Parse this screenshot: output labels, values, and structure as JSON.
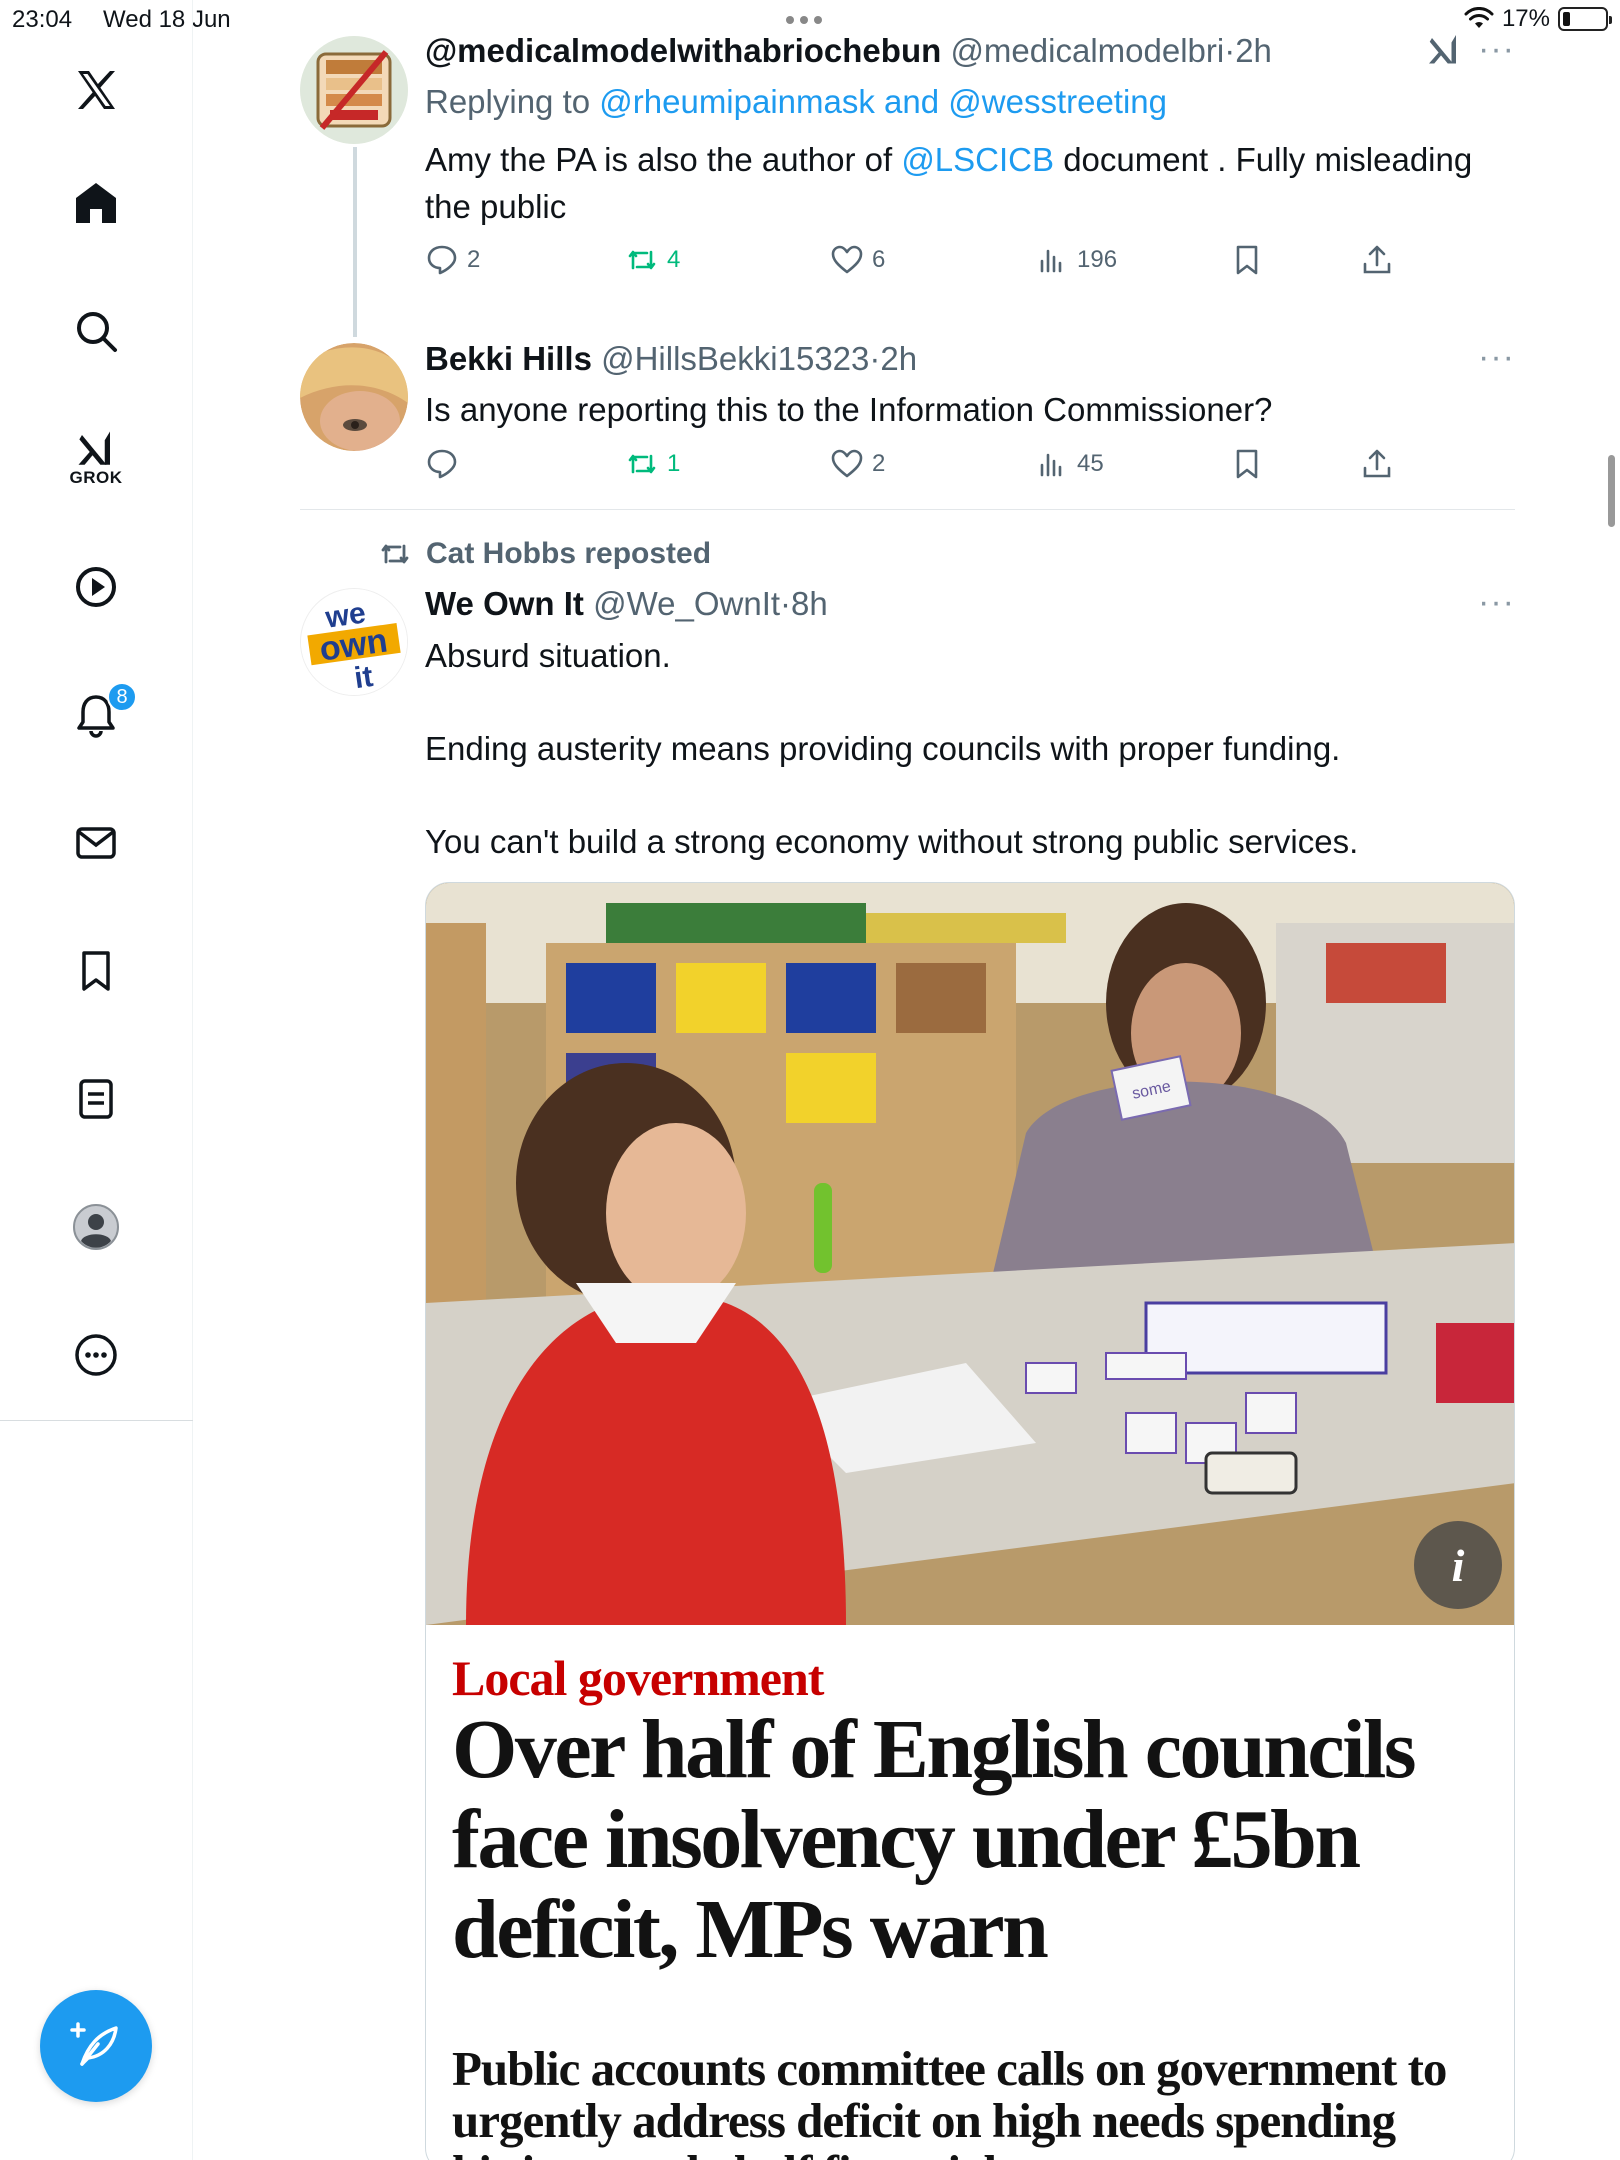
{
  "status_bar": {
    "time": "23:04",
    "date": "Wed 18 Jun",
    "battery_percent_label": "17%",
    "battery_level": 0.17
  },
  "sidebar": {
    "items": [
      {
        "icon": "x-logo-icon"
      },
      {
        "icon": "home-icon"
      },
      {
        "icon": "search-icon"
      },
      {
        "icon": "grok-icon",
        "label": "GROK"
      },
      {
        "icon": "video-play-icon"
      },
      {
        "icon": "notifications-bell-icon",
        "badge": "8"
      },
      {
        "icon": "messages-envelope-icon"
      },
      {
        "icon": "bookmarks-icon"
      },
      {
        "icon": "lists-icon"
      },
      {
        "icon": "profile-avatar-icon"
      },
      {
        "icon": "more-circle-icon"
      }
    ],
    "compose_icon": "compose-feather-icon"
  },
  "colors": {
    "accent": "#1d9bf0",
    "repost_green": "#00ba7c",
    "meta_grey": "#536471",
    "kicker_red": "#c70000"
  },
  "tweets": [
    {
      "name": "@medicalmodelwithabriochebun",
      "handle": "@medicalmodelbri",
      "dot": "·",
      "time": "2h",
      "reply_prefix": "Replying to ",
      "reply_targets": "@rheumipainmask and @wesstreeting",
      "text_before": "Amy the PA is also the author of ",
      "text_mention": "@LSCICB",
      "text_after": " document . Fully misleading the public",
      "replies": "2",
      "reposts": "4",
      "likes": "6",
      "views": "196"
    },
    {
      "name": "Bekki Hills",
      "handle": "@HillsBekki15323",
      "dot": "·",
      "time": "2h",
      "text": "Is anyone reporting this to the Information Commissioner?",
      "replies": "",
      "reposts": "1",
      "likes": "2",
      "views": "45"
    },
    {
      "reposted_by": "Cat Hobbs reposted",
      "name": "We Own It",
      "handle": "@We_OwnIt",
      "dot": "·",
      "time": "8h",
      "avatar_text": [
        "we",
        "own",
        "it"
      ],
      "text_line1": "Absurd situation.",
      "text_line2": "Ending austerity means providing councils with proper funding.",
      "text_line3": "You can't build a strong economy without strong public services.",
      "card": {
        "kicker": "Local government",
        "headline": "Over half of English councils face insolvency under £5bn deficit, MPs warn",
        "standfirst": "Public accounts committee calls on government to urgently address deficit on high needs spending hitting nearly half financial",
        "info_button": "i",
        "image_flashcard_word": "some"
      }
    }
  ]
}
